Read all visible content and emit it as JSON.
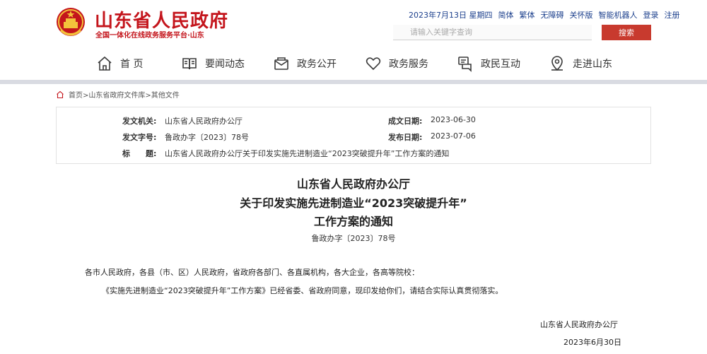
{
  "header": {
    "site_title": "山东省人民政府",
    "site_subtitle": "全国一体化在线政务服务平台·山东",
    "date": "2023年7月13日 星期四",
    "links": [
      "简体",
      "繁体",
      "无障碍",
      "关怀版",
      "智能机器人",
      "登录",
      "注册"
    ]
  },
  "search": {
    "placeholder": "请输入关键字查询",
    "button_label": "搜索"
  },
  "nav": {
    "items": [
      {
        "label": "首 页",
        "icon": "home-icon"
      },
      {
        "label": "要闻动态",
        "icon": "book-icon"
      },
      {
        "label": "政务公开",
        "icon": "mail-icon"
      },
      {
        "label": "政务服务",
        "icon": "heart-icon"
      },
      {
        "label": "政民互动",
        "icon": "chat-icon"
      },
      {
        "label": "走进山东",
        "icon": "map-pin-icon"
      }
    ]
  },
  "breadcrumb": {
    "text": "首页>山东省政府文件库>其他文件"
  },
  "meta": {
    "issuer_label": "发文机关:",
    "issuer_value": "山东省人民政府办公厅",
    "doc_no_label": "发文字号:",
    "doc_no_value": "鲁政办字〔2023〕78号",
    "title_label": "标　　题:",
    "title_value": "山东省人民政府办公厅关于印发实施先进制造业“2023突破提升年”工作方案的通知",
    "written_date_label": "成文日期:",
    "written_date_value": "2023-06-30",
    "publish_date_label": "发布日期:",
    "publish_date_value": "2023-07-06"
  },
  "document": {
    "title_line1": "山东省人民政府办公厅",
    "title_line2": "关于印发实施先进制造业“2023突破提升年”",
    "title_line3": "工作方案的通知",
    "number": "鲁政办字〔2023〕78号",
    "addressees": "各市人民政府，各县（市、区）人民政府，省政府各部门、各直属机构，各大企业，各高等院校：",
    "paragraph": "《实施先进制造业“2023突破提升年”工作方案》已经省委、省政府同意，现印发给你们，请结合实际认真贯彻落实。",
    "signature": "山东省人民政府办公厅",
    "sign_date": "2023年6月30日"
  },
  "colors": {
    "brand_red": "#c4151c",
    "link_blue": "#1b3f8c",
    "search_button": "#c83a2e"
  }
}
